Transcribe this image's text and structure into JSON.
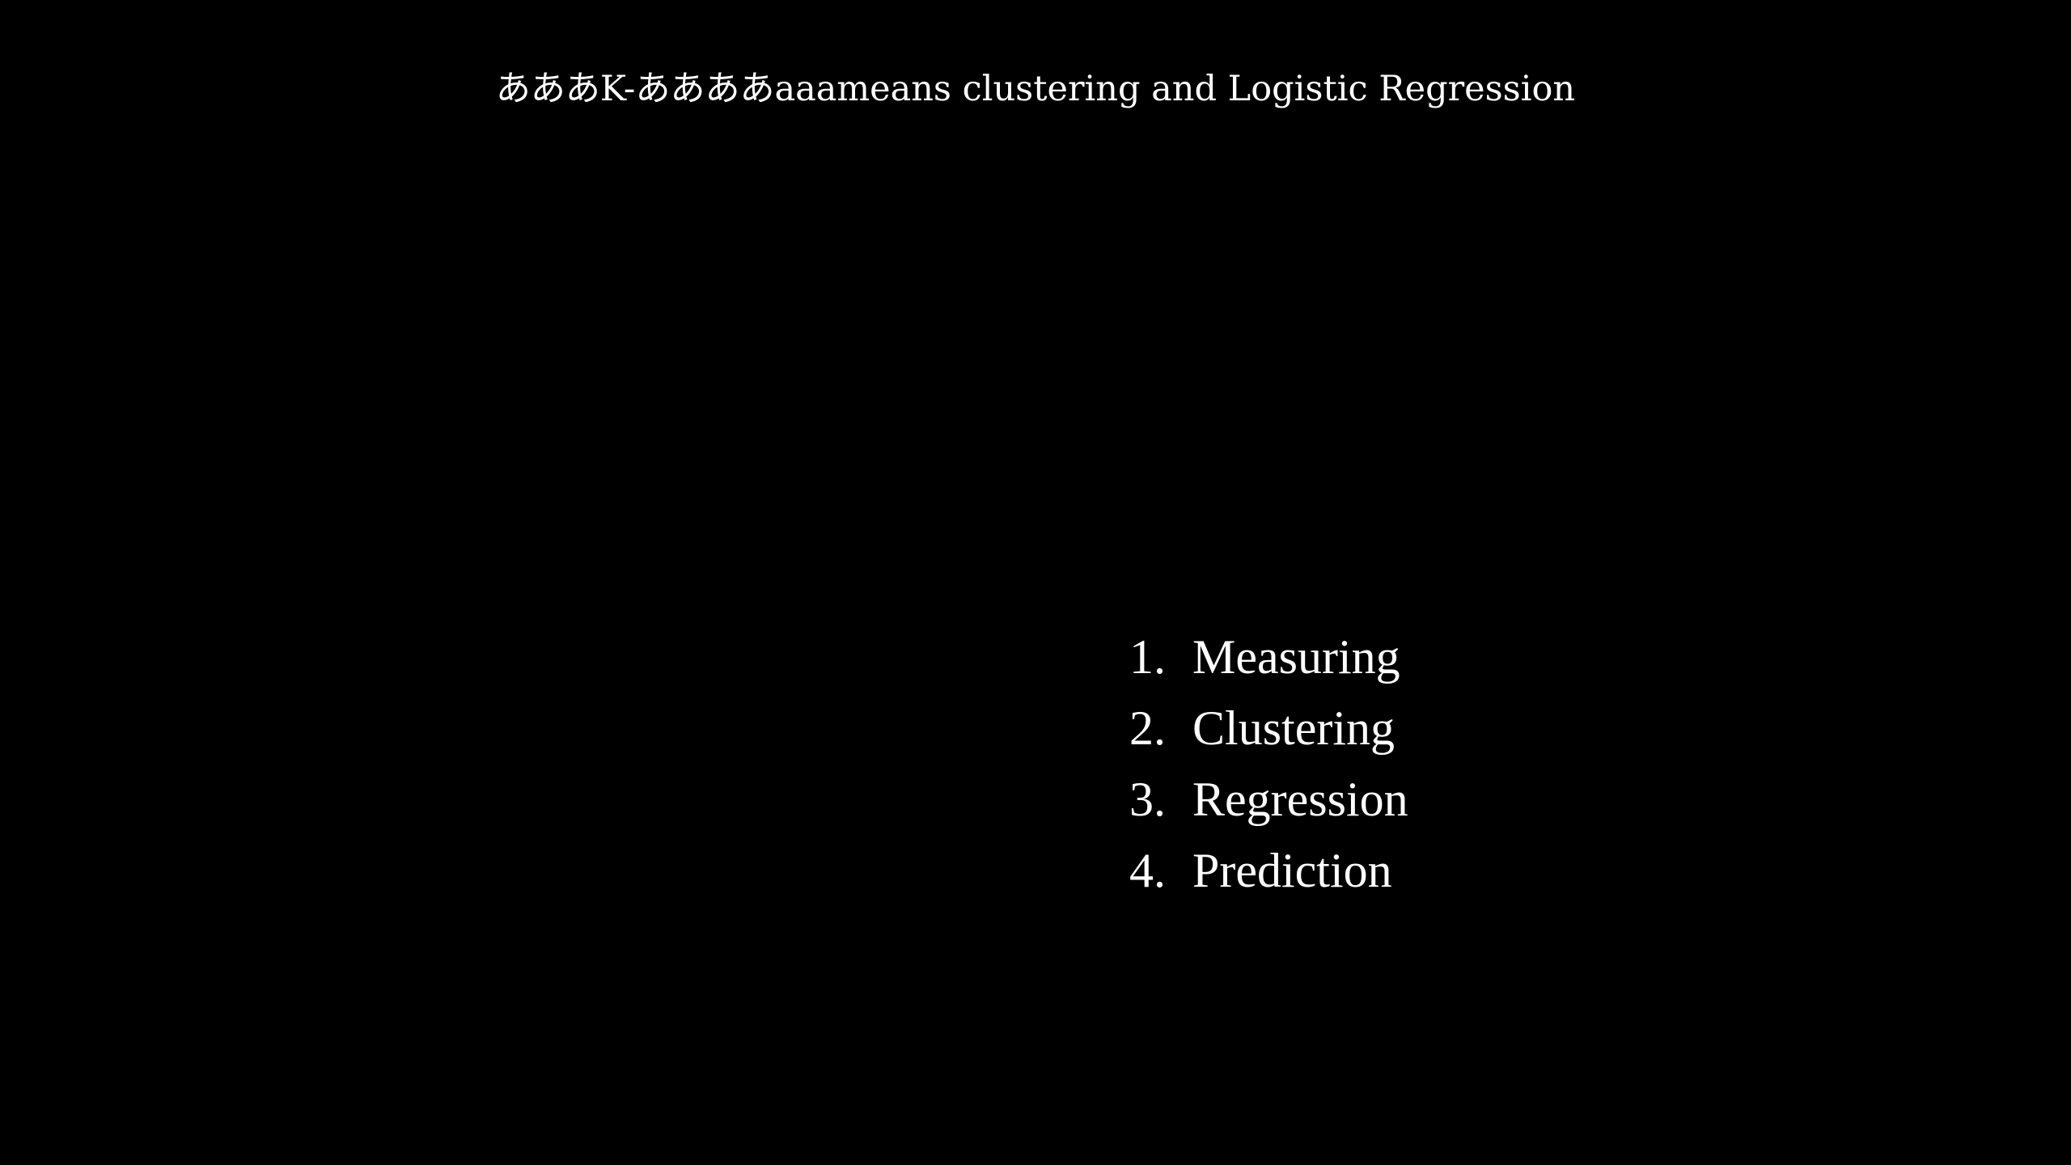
{
  "slide": {
    "title": "あああK-ああああaaameans clustering and Logistic Regression",
    "agenda": [
      {
        "number": "1.",
        "label": "Measuring"
      },
      {
        "number": "2.",
        "label": "Clustering"
      },
      {
        "number": "3.",
        "label": "Regression"
      },
      {
        "number": "4.",
        "label": "Prediction"
      }
    ]
  },
  "colors": {
    "background": "#000000",
    "text": "#ffffff"
  }
}
